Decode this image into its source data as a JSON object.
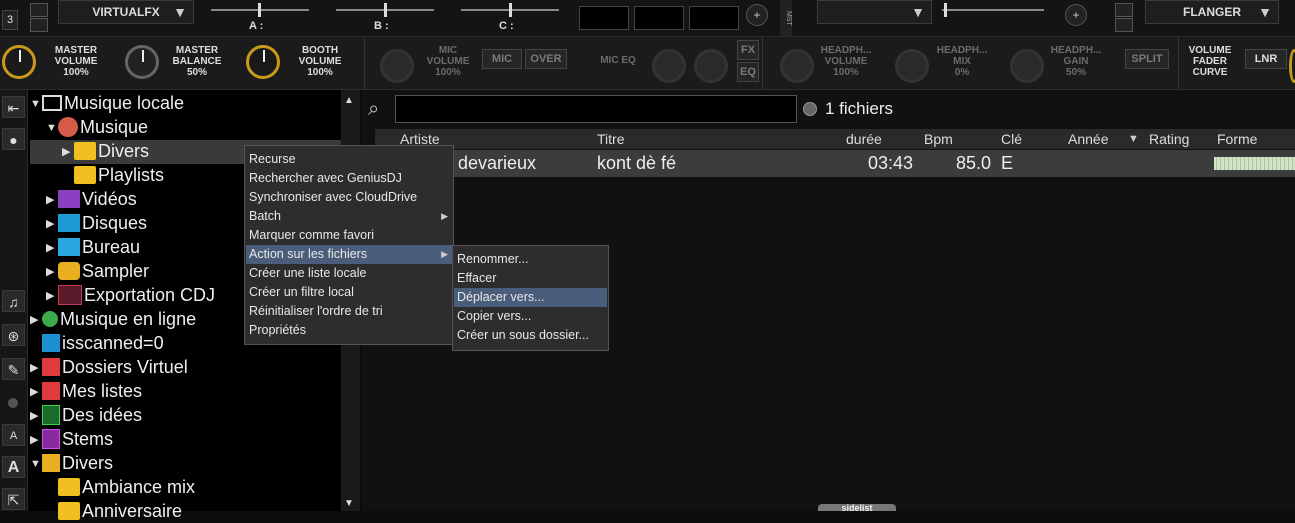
{
  "top": {
    "deck_num": "3",
    "left_dropdown": "VIRTUALFX",
    "sliders": [
      "A :",
      "B :",
      "C :"
    ],
    "plus": "+",
    "mst_label": "MST",
    "right_dropdown": "FLANGER"
  },
  "mixer": {
    "master_volume": {
      "label1": "MASTER",
      "label2": "VOLUME",
      "value": "100%"
    },
    "master_balance": {
      "label1": "MASTER",
      "label2": "BALANCE",
      "value": "50%"
    },
    "booth_volume": {
      "label1": "BOOTH",
      "label2": "VOLUME",
      "value": "100%"
    },
    "mic_volume": {
      "label1": "MIC",
      "label2": "VOLUME",
      "value": "100%"
    },
    "mic_btn": "MIC",
    "over_btn": "OVER",
    "mic_eq": "MIC EQ",
    "fx_btn": "FX",
    "eq_btn": "EQ",
    "headphones_volume": {
      "label1": "HEADPH...",
      "label2": "VOLUME",
      "value": "100%"
    },
    "headphones_mix": {
      "label1": "HEADPH...",
      "label2": "MIX",
      "value": "0%"
    },
    "headphones_gain": {
      "label1": "HEADPH...",
      "label2": "GAIN",
      "value": "50%"
    },
    "split_btn": "SPLIT",
    "volume_fader_curve": {
      "label1": "VOLUME",
      "label2": "FADER",
      "label3": "CURVE"
    },
    "lnr_btn": "LNR"
  },
  "tree": [
    {
      "label": "Musique locale",
      "icon": "computer-icon"
    },
    {
      "label": "Musique",
      "icon": "music-icon"
    },
    {
      "label": "Divers",
      "icon": "folder-icon"
    },
    {
      "label": "Playlists",
      "icon": "folder-icon"
    },
    {
      "label": "Vidéos",
      "icon": "video-icon"
    },
    {
      "label": "Disques",
      "icon": "monitor-icon"
    },
    {
      "label": "Bureau",
      "icon": "desktop-icon"
    },
    {
      "label": "Sampler",
      "icon": "drum-icon"
    },
    {
      "label": "Exportation CDJ",
      "icon": "cdj-icon"
    },
    {
      "label": "Musique en ligne",
      "icon": "globe-icon"
    },
    {
      "label": "isscanned=0",
      "icon": "filter-icon"
    },
    {
      "label": "Dossiers Virtuel",
      "icon": "virtual-folder-icon"
    },
    {
      "label": "Mes listes",
      "icon": "list-icon"
    },
    {
      "label": "Des idées",
      "icon": "idea-icon"
    },
    {
      "label": "Stems",
      "icon": "stems-icon"
    },
    {
      "label": "Divers",
      "icon": "heart-folder-icon"
    },
    {
      "label": "Ambiance mix",
      "icon": "folder-icon"
    },
    {
      "label": "Anniversaire",
      "icon": "folder-icon"
    }
  ],
  "search": {
    "placeholder": "",
    "count": "1 fichiers"
  },
  "columns": [
    "Artiste",
    "Titre",
    "durée",
    "Bpm",
    "Clé",
    "Année",
    "Rating",
    "Forme d'onde"
  ],
  "rows": [
    {
      "artist": "devarieux",
      "title": "kont dè fé",
      "duration": "03:43",
      "bpm": "85.0",
      "key": "E"
    }
  ],
  "context_menu": [
    "Recurse",
    "Rechercher avec GeniusDJ",
    "Synchroniser avec CloudDrive",
    "Batch",
    "Marquer comme favori",
    "Action sur les fichiers",
    "Créer une liste locale",
    "Créer un filtre local",
    "Réinitialiser l'ordre de tri",
    "Propriétés"
  ],
  "submenu": [
    "Renommer...",
    "Effacer",
    "Déplacer vers...",
    "Copier vers...",
    "Créer un sous dossier..."
  ],
  "sidelist": "sidelist",
  "colors": {
    "knob_accent": "#c89a1a",
    "highlight": "#4a5d7a"
  }
}
